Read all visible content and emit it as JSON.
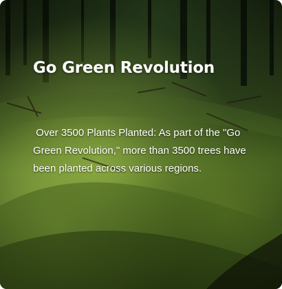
{
  "card": {
    "title": "Go Green Revolution",
    "description": " Over 3500 Plants Planted: As part of the \"Go Green Revolution,\" more than 3500 trees have been planted across various regions."
  },
  "colors": {
    "text": "#ffffff",
    "moss_light": "#7aa03a",
    "moss_dark": "#2d4317",
    "forest_shadow": "#0d140a"
  },
  "icons": []
}
